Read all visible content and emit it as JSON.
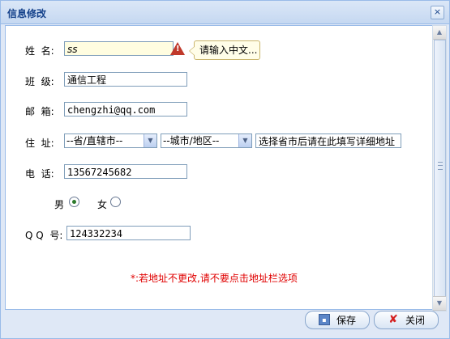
{
  "window": {
    "title": "信息修改",
    "close_glyph": "×"
  },
  "form": {
    "name_label": "姓  名:",
    "name_value": "ss",
    "name_tooltip": "请输入中文...",
    "class_label": "班  级:",
    "class_value": "通信工程",
    "email_label": "邮  箱:",
    "email_value": "chengzhi@qq.com",
    "address_label": "住  址:",
    "province_selected": "--省/直辖市--",
    "city_selected": "--城市/地区--",
    "address_detail_value": "选择省市后请在此填写详细地址",
    "phone_label": "电  话:",
    "phone_value": "13567245682",
    "gender_male_label": "男",
    "gender_female_label": "女",
    "gender_selected": "男",
    "qq_label": "Q Q  号:",
    "qq_value": "124332234",
    "note": "*:若地址不更改,请不要点击地址栏选项"
  },
  "footer": {
    "save_label": "保存",
    "close_label": "关闭"
  },
  "colors": {
    "title": "#15428b",
    "warning": "#c0392b",
    "note": "#e00000",
    "border": "#99bbe8"
  }
}
